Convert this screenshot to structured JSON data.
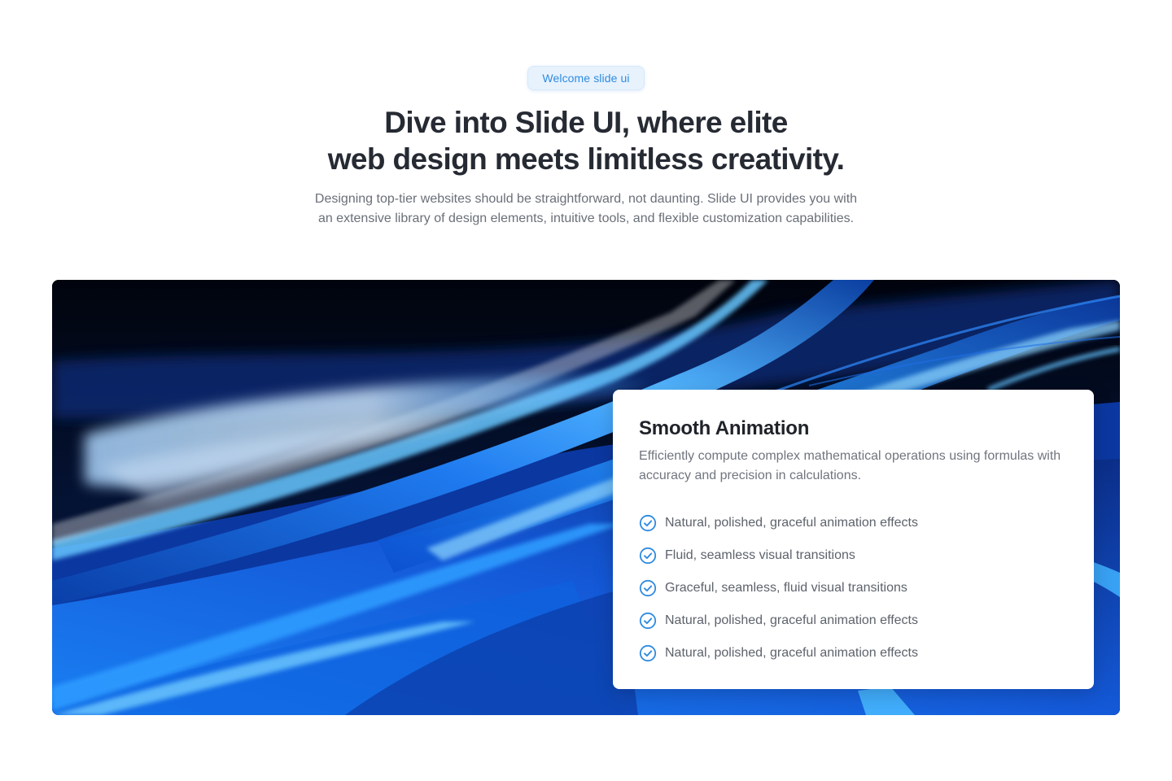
{
  "badge": {
    "label": "Welcome slide ui"
  },
  "headline": {
    "line1": "Dive into Slide UI, where elite",
    "line2": "web design meets limitless creativity."
  },
  "subtext": {
    "line1": "Designing top-tier websites should be straightforward, not daunting. Slide UI provides you with",
    "line2": "an extensive library of design elements, intuitive tools, and flexible customization capabilities."
  },
  "hero": {
    "image": "abstract-blue-light-waves"
  },
  "card": {
    "title": "Smooth Animation",
    "description": "Efficiently compute complex mathematical operations using formulas with accuracy and precision in calculations.",
    "features": [
      {
        "icon": "check-circle-icon",
        "text": "Natural, polished, graceful animation effects"
      },
      {
        "icon": "check-circle-icon",
        "text": "Fluid, seamless visual transitions"
      },
      {
        "icon": "check-circle-icon",
        "text": "Graceful, seamless, fluid visual transitions"
      },
      {
        "icon": "check-circle-icon",
        "text": "Natural, polished, graceful animation effects"
      },
      {
        "icon": "check-circle-icon",
        "text": "Natural, polished, graceful animation effects"
      }
    ]
  },
  "colors": {
    "accent": "#2f8be0",
    "badge_bg": "#e7f2fd",
    "heading": "#262a33",
    "body_text": "#6a6f78",
    "hero_dark": "#020817",
    "hero_blue": "#1e73e8"
  }
}
